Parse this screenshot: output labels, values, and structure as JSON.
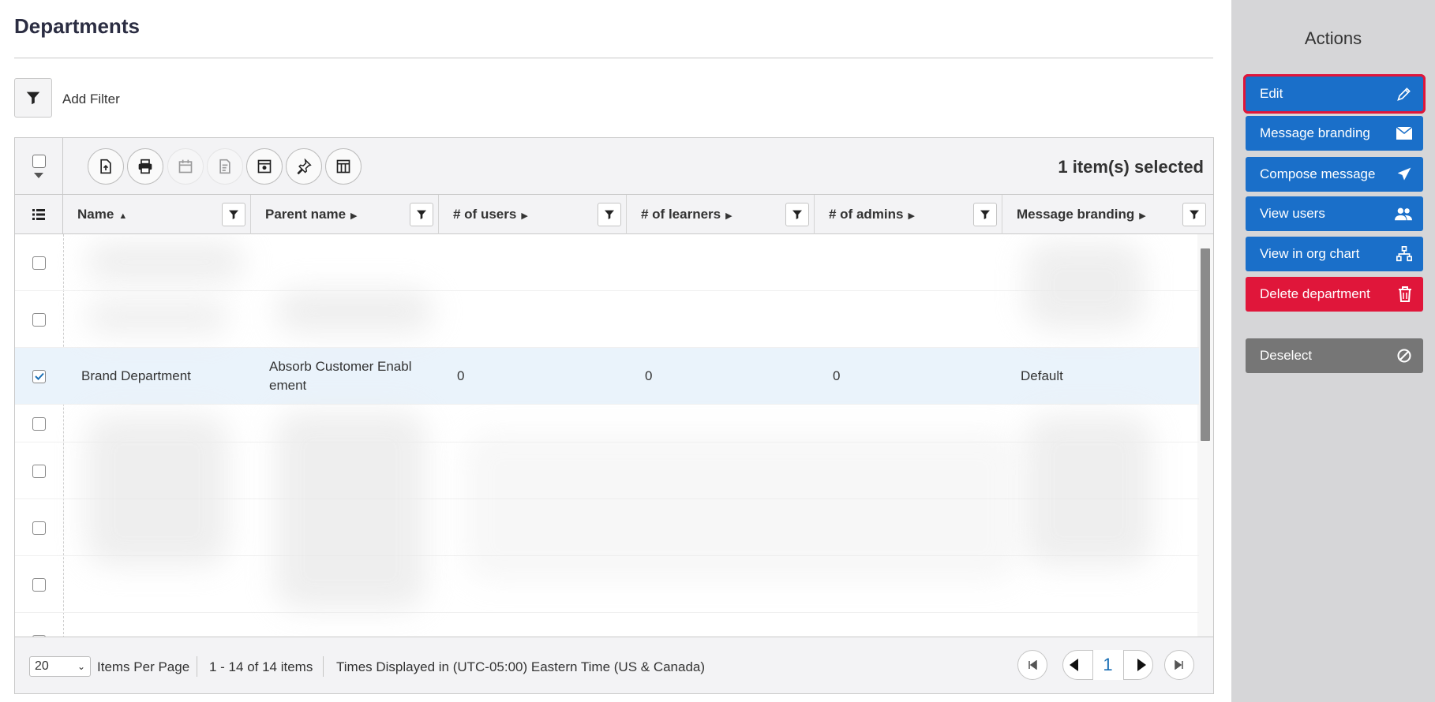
{
  "page": {
    "title": "Departments"
  },
  "filter": {
    "label": "Add Filter"
  },
  "toolbar": {
    "icons": [
      "export-icon",
      "print-icon",
      "calendar-icon",
      "report-icon",
      "schedule-icon",
      "pin-icon",
      "columns-icon"
    ],
    "selected_text": "1 item(s) selected"
  },
  "columns": [
    {
      "label": "Name",
      "sort": "▲"
    },
    {
      "label": "Parent name",
      "sort": "▶"
    },
    {
      "label": "# of users",
      "sort": "▶"
    },
    {
      "label": "# of learners",
      "sort": "▶"
    },
    {
      "label": "# of admins",
      "sort": "▶"
    },
    {
      "label": "Message branding",
      "sort": "▶"
    }
  ],
  "selected_row": {
    "name": "Brand Department",
    "parent_line1": "Absorb Customer Enabl",
    "parent_line2": "ement",
    "users": "0",
    "learners": "0",
    "admins": "0",
    "branding": "Default"
  },
  "footer": {
    "per_page": "20",
    "per_page_label": "Items Per Page",
    "range": "1 - 14 of 14 items",
    "timezone": "Times Displayed in (UTC-05:00) Eastern Time (US & Canada)",
    "current_page": "1"
  },
  "sidebar": {
    "title": "Actions",
    "actions": [
      {
        "label": "Edit",
        "icon": "pencil-icon"
      },
      {
        "label": "Message branding",
        "icon": "envelope-icon"
      },
      {
        "label": "Compose message",
        "icon": "paper-plane-icon"
      },
      {
        "label": "View users",
        "icon": "users-icon"
      },
      {
        "label": "View in org chart",
        "icon": "org-chart-icon"
      },
      {
        "label": "Delete department",
        "icon": "trash-icon"
      },
      {
        "label": "Deselect",
        "icon": "ban-icon"
      }
    ]
  },
  "colors": {
    "primary": "#1a6fc9",
    "danger": "#e0163a",
    "neutral": "#767676",
    "sidebar_bg": "#d6d6d8"
  }
}
